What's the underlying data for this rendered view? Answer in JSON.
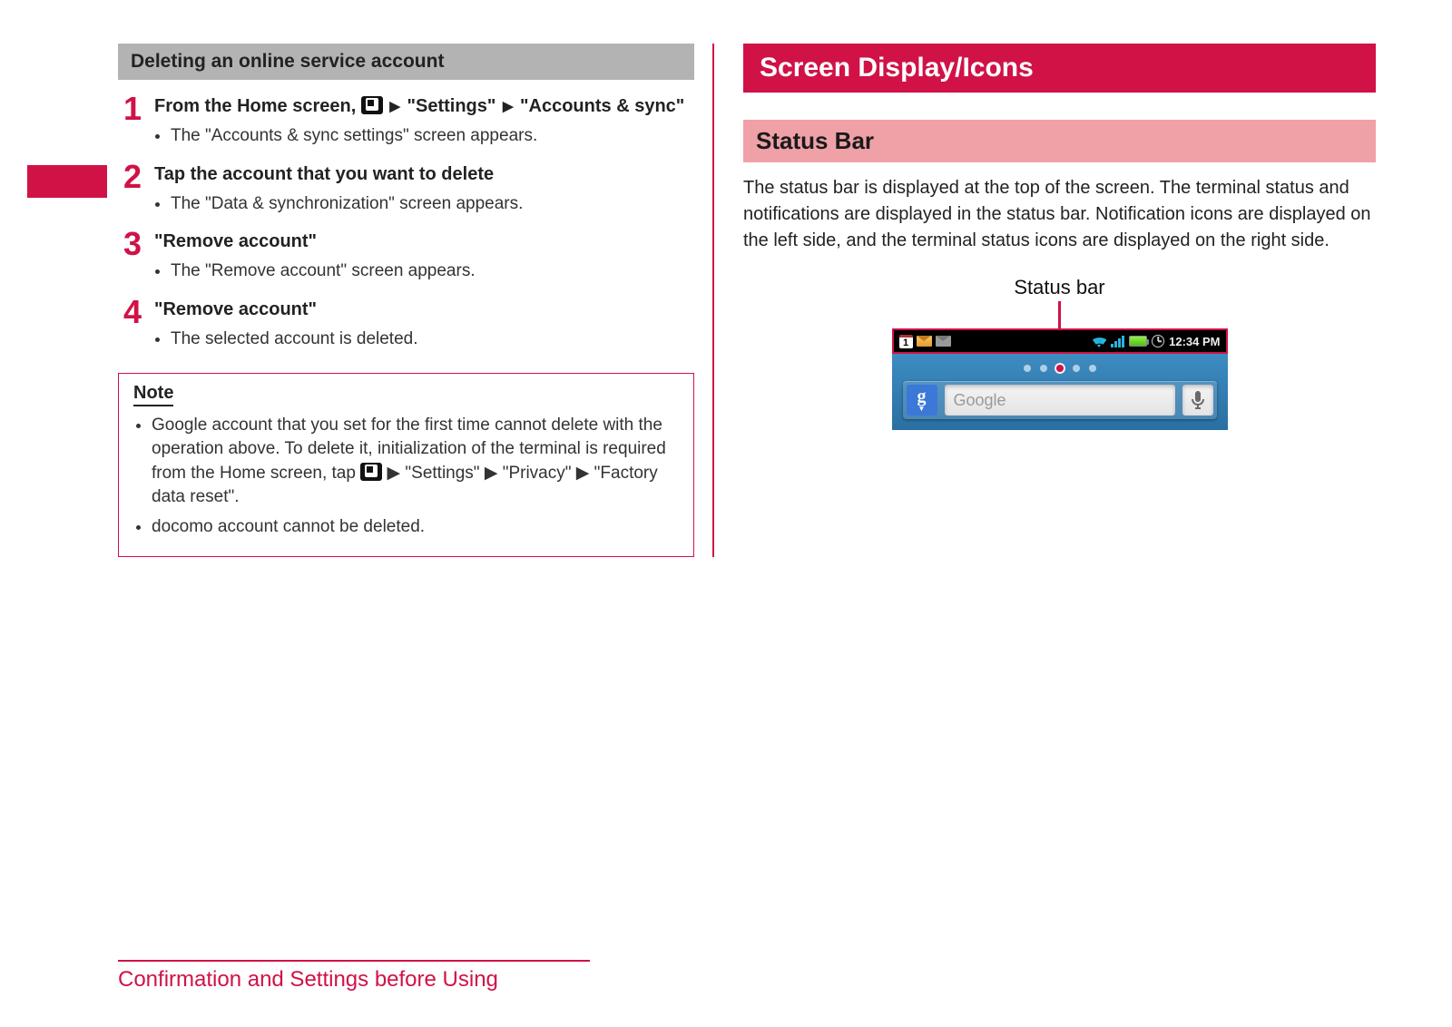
{
  "left": {
    "section_title": "Deleting an online service account",
    "steps": [
      {
        "title_pre": "From the Home screen, ",
        "title_post1": " \"Settings\" ",
        "title_post2": " \"Accounts & sync\"",
        "bullets": [
          "The \"Accounts & sync settings\" screen appears."
        ]
      },
      {
        "title": "Tap the account that you want to delete",
        "bullets": [
          "The \"Data & synchronization\" screen appears."
        ]
      },
      {
        "title": "\"Remove account\"",
        "bullets": [
          "The \"Remove account\" screen appears."
        ]
      },
      {
        "title": "\"Remove account\"",
        "bullets": [
          "The selected account is deleted."
        ]
      }
    ],
    "note": {
      "heading": "Note",
      "items_part1_pre": "Google account that you set for the first time cannot delete with the operation above. To delete it, initialization of the terminal is required from the Home screen, tap ",
      "items_part1_path": " \"Settings\" ▶ \"Privacy\" ▶ \"Factory data reset\".",
      "item2": "docomo account cannot be deleted."
    }
  },
  "right": {
    "red_header": "Screen Display/Icons",
    "pink_header": "Status Bar",
    "body": "The status bar is displayed at the top of the screen. The terminal status and notifications are displayed in the status bar. Notification icons are displayed on the left side, and the terminal status icons are displayed on the right side.",
    "shot_label": "Status bar",
    "statusbar": {
      "cal_day": "1",
      "time": "12:34 PM"
    },
    "search_placeholder": "Google"
  },
  "footer": "Confirmation and Settings before Using",
  "glyphs": {
    "tri": "▶"
  }
}
